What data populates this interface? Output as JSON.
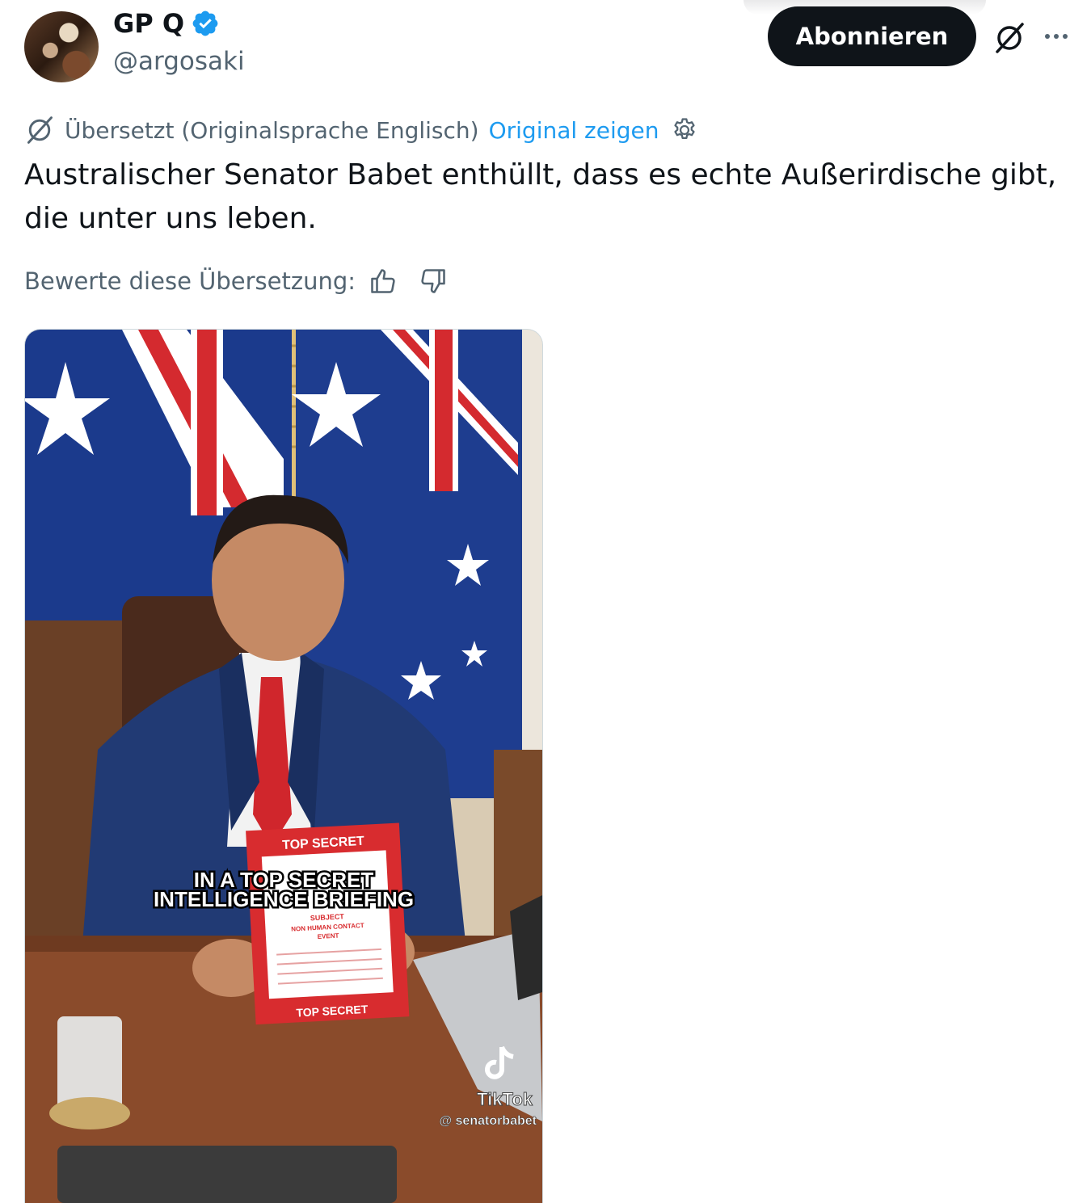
{
  "author": {
    "name": "GP Q",
    "handle": "@argosaki",
    "verified": true
  },
  "actions": {
    "subscribe_label": "Abonnieren",
    "grok_icon": "grok-icon",
    "more_icon": "more-icon"
  },
  "translation": {
    "notice": "Übersetzt (Originalsprache Englisch)",
    "show_original": "Original zeigen",
    "settings_icon": "gear-icon"
  },
  "tweet": {
    "text": "Australischer Senator Babet enthüllt, dass es echte Außerirdische gibt, die unter uns leben."
  },
  "rating": {
    "label": "Bewerte diese Übersetzung:",
    "up_icon": "thumbs-up-icon",
    "down_icon": "thumbs-down-icon"
  },
  "media": {
    "caption_line1": "IN A TOP SECRET",
    "caption_line2": "INTELLIGENCE BRIEFING",
    "doc_header": "TOP SECRET",
    "doc_footer": "TOP SECRET",
    "doc_subject": "SUBJECT",
    "doc_subtitle1": "NON HUMAN CONTACT",
    "doc_subtitle2": "EVENT",
    "watermark_brand": "TikTok",
    "watermark_handle": "@ senatorbabet"
  },
  "colors": {
    "accent": "#1d9bf0",
    "text": "#0f1419",
    "secondary": "#536471"
  }
}
